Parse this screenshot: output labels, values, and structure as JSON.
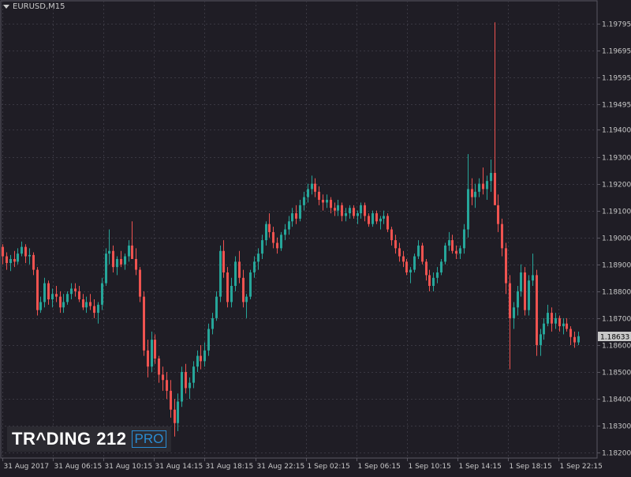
{
  "chart_data": {
    "type": "candlestick",
    "symbol": "EURUSD,M15",
    "current_price": "1.18633",
    "ylim": [
      1.1818,
      1.1988
    ],
    "y_ticks": [
      "1.19795",
      "1.19695",
      "1.19595",
      "1.19495",
      "1.19400",
      "1.19300",
      "1.19200",
      "1.19100",
      "1.19000",
      "1.18900",
      "1.18800",
      "1.18700",
      "1.18600",
      "1.18500",
      "1.18400",
      "1.18300",
      "1.18200"
    ],
    "x_ticks": [
      "31 Aug 2017",
      "31 Aug 06:15",
      "31 Aug 10:15",
      "31 Aug 14:15",
      "31 Aug 18:15",
      "31 Aug 22:15",
      "1 Sep 02:15",
      "1 Sep 06:15",
      "1 Sep 10:15",
      "1 Sep 14:15",
      "1 Sep 18:15",
      "1 Sep 22:15"
    ],
    "grid": true,
    "colors": {
      "up": "#26a69a",
      "down": "#ef5350",
      "grid": "#3a3842",
      "axis": "#5a5862",
      "text": "#c8c8c8",
      "background": "#1f1d25"
    },
    "candles": [
      [
        1.18965,
        1.18975,
        1.189,
        1.1893
      ],
      [
        1.1893,
        1.18945,
        1.1888,
        1.18905
      ],
      [
        1.18905,
        1.18935,
        1.18875,
        1.1892
      ],
      [
        1.1892,
        1.1895,
        1.1889,
        1.1891
      ],
      [
        1.1891,
        1.1896,
        1.189,
        1.1894
      ],
      [
        1.1894,
        1.18985,
        1.1893,
        1.18965
      ],
      [
        1.18965,
        1.18975,
        1.18905,
        1.1893
      ],
      [
        1.1893,
        1.1896,
        1.189,
        1.18935
      ],
      [
        1.18935,
        1.18945,
        1.1886,
        1.1888
      ],
      [
        1.1888,
        1.1889,
        1.1871,
        1.1873
      ],
      [
        1.1873,
        1.1878,
        1.1872,
        1.1876
      ],
      [
        1.1876,
        1.1885,
        1.1874,
        1.1883
      ],
      [
        1.1883,
        1.1884,
        1.1875,
        1.1877
      ],
      [
        1.1877,
        1.1881,
        1.1874,
        1.1879
      ],
      [
        1.1879,
        1.1882,
        1.1876,
        1.1878
      ],
      [
        1.1878,
        1.188,
        1.1872,
        1.1874
      ],
      [
        1.1874,
        1.1879,
        1.1872,
        1.1876
      ],
      [
        1.1876,
        1.188,
        1.1875,
        1.1879
      ],
      [
        1.1879,
        1.1883,
        1.1877,
        1.1881
      ],
      [
        1.1881,
        1.1883,
        1.1878,
        1.188
      ],
      [
        1.188,
        1.1882,
        1.1876,
        1.1877
      ],
      [
        1.1877,
        1.1879,
        1.1873,
        1.1874
      ],
      [
        1.1874,
        1.1878,
        1.1872,
        1.1876
      ],
      [
        1.1876,
        1.1879,
        1.1873,
        1.18745
      ],
      [
        1.18745,
        1.1877,
        1.187,
        1.1872
      ],
      [
        1.1872,
        1.1876,
        1.1868,
        1.1875
      ],
      [
        1.1875,
        1.1885,
        1.1873,
        1.1883
      ],
      [
        1.1883,
        1.1896,
        1.1882,
        1.1894
      ],
      [
        1.1894,
        1.1903,
        1.189,
        1.1895
      ],
      [
        1.1895,
        1.1897,
        1.1887,
        1.1889
      ],
      [
        1.1889,
        1.1893,
        1.1886,
        1.1892
      ],
      [
        1.1892,
        1.1895,
        1.1889,
        1.189
      ],
      [
        1.189,
        1.1894,
        1.1888,
        1.1893
      ],
      [
        1.1893,
        1.1899,
        1.1891,
        1.1897
      ],
      [
        1.1897,
        1.1906,
        1.1894,
        1.1892
      ],
      [
        1.1892,
        1.1896,
        1.1886,
        1.1888
      ],
      [
        1.1888,
        1.1889,
        1.1876,
        1.1878
      ],
      [
        1.1878,
        1.188,
        1.1856,
        1.1858
      ],
      [
        1.1858,
        1.1862,
        1.1848,
        1.1852
      ],
      [
        1.1852,
        1.1865,
        1.185,
        1.1862
      ],
      [
        1.1862,
        1.1864,
        1.1853,
        1.1855
      ],
      [
        1.1855,
        1.1856,
        1.1846,
        1.1849
      ],
      [
        1.1849,
        1.1852,
        1.1843,
        1.1847
      ],
      [
        1.1847,
        1.185,
        1.184,
        1.1843
      ],
      [
        1.1843,
        1.1847,
        1.1833,
        1.1836
      ],
      [
        1.1836,
        1.184,
        1.1826,
        1.1831
      ],
      [
        1.1831,
        1.1842,
        1.1828,
        1.1839
      ],
      [
        1.1839,
        1.1852,
        1.1837,
        1.185
      ],
      [
        1.185,
        1.1853,
        1.1842,
        1.1844
      ],
      [
        1.1844,
        1.1848,
        1.184,
        1.1846
      ],
      [
        1.1846,
        1.1854,
        1.1844,
        1.1852
      ],
      [
        1.1852,
        1.1858,
        1.185,
        1.1856
      ],
      [
        1.1856,
        1.186,
        1.1851,
        1.1854
      ],
      [
        1.1854,
        1.1861,
        1.1852,
        1.1858
      ],
      [
        1.1858,
        1.1868,
        1.1856,
        1.1866
      ],
      [
        1.1866,
        1.1872,
        1.1864,
        1.187
      ],
      [
        1.187,
        1.188,
        1.1869,
        1.1878
      ],
      [
        1.1878,
        1.1897,
        1.1876,
        1.1895
      ],
      [
        1.1895,
        1.1899,
        1.1885,
        1.1887
      ],
      [
        1.1887,
        1.1889,
        1.1874,
        1.1876
      ],
      [
        1.1876,
        1.1885,
        1.1874,
        1.1882
      ],
      [
        1.1882,
        1.1893,
        1.188,
        1.1891
      ],
      [
        1.1891,
        1.1895,
        1.1883,
        1.1885
      ],
      [
        1.1885,
        1.1888,
        1.1874,
        1.1876
      ],
      [
        1.1876,
        1.1879,
        1.187,
        1.1878
      ],
      [
        1.1878,
        1.1888,
        1.1877,
        1.1887
      ],
      [
        1.1887,
        1.1893,
        1.1885,
        1.1891
      ],
      [
        1.1891,
        1.1896,
        1.1888,
        1.1894
      ],
      [
        1.1894,
        1.1901,
        1.1892,
        1.1899
      ],
      [
        1.1899,
        1.1906,
        1.1897,
        1.1905
      ],
      [
        1.1905,
        1.1909,
        1.19,
        1.1902
      ],
      [
        1.1902,
        1.1904,
        1.1896,
        1.1898
      ],
      [
        1.1898,
        1.19,
        1.1894,
        1.1896
      ],
      [
        1.1896,
        1.1902,
        1.1895,
        1.1901
      ],
      [
        1.1901,
        1.1905,
        1.1899,
        1.1903
      ],
      [
        1.1903,
        1.1908,
        1.1901,
        1.1906
      ],
      [
        1.1906,
        1.1911,
        1.1904,
        1.1909
      ],
      [
        1.1909,
        1.1912,
        1.1905,
        1.1907
      ],
      [
        1.1907,
        1.1914,
        1.1906,
        1.1912
      ],
      [
        1.1912,
        1.1917,
        1.191,
        1.1915
      ],
      [
        1.1915,
        1.192,
        1.1913,
        1.1918
      ],
      [
        1.1918,
        1.1923,
        1.1916,
        1.192
      ],
      [
        1.192,
        1.1922,
        1.1915,
        1.1917
      ],
      [
        1.1917,
        1.1919,
        1.1912,
        1.1914
      ],
      [
        1.1914,
        1.1916,
        1.191,
        1.1913
      ],
      [
        1.1913,
        1.1916,
        1.1911,
        1.1914
      ],
      [
        1.1914,
        1.1915,
        1.1909,
        1.1911
      ],
      [
        1.1911,
        1.1913,
        1.1908,
        1.191
      ],
      [
        1.191,
        1.1914,
        1.1908,
        1.1912
      ],
      [
        1.1912,
        1.1913,
        1.1906,
        1.1908
      ],
      [
        1.1908,
        1.1911,
        1.1906,
        1.1909
      ],
      [
        1.1909,
        1.1912,
        1.1907,
        1.1911
      ],
      [
        1.1911,
        1.1912,
        1.1907,
        1.1908
      ],
      [
        1.1908,
        1.191,
        1.1905,
        1.1909
      ],
      [
        1.1909,
        1.1913,
        1.1907,
        1.1912
      ],
      [
        1.1912,
        1.1913,
        1.1906,
        1.1908
      ],
      [
        1.1908,
        1.1909,
        1.1904,
        1.1905
      ],
      [
        1.1905,
        1.191,
        1.1904,
        1.1909
      ],
      [
        1.1909,
        1.191,
        1.1905,
        1.1906
      ],
      [
        1.1906,
        1.1908,
        1.1903,
        1.1907
      ],
      [
        1.1907,
        1.191,
        1.1905,
        1.1908
      ],
      [
        1.1908,
        1.1909,
        1.1902,
        1.1903
      ],
      [
        1.1903,
        1.1904,
        1.1897,
        1.1899
      ],
      [
        1.1899,
        1.1901,
        1.1894,
        1.1896
      ],
      [
        1.1896,
        1.1898,
        1.1891,
        1.1893
      ],
      [
        1.1893,
        1.1895,
        1.1889,
        1.1891
      ],
      [
        1.1891,
        1.1892,
        1.1886,
        1.1887
      ],
      [
        1.1887,
        1.1889,
        1.1883,
        1.1888
      ],
      [
        1.1888,
        1.1894,
        1.1887,
        1.1893
      ],
      [
        1.1893,
        1.1899,
        1.1892,
        1.1897
      ],
      [
        1.1897,
        1.1898,
        1.189,
        1.1891
      ],
      [
        1.1891,
        1.1892,
        1.1884,
        1.1886
      ],
      [
        1.1886,
        1.1888,
        1.188,
        1.1882
      ],
      [
        1.1882,
        1.1887,
        1.188,
        1.1885
      ],
      [
        1.1885,
        1.1889,
        1.1883,
        1.1887
      ],
      [
        1.1887,
        1.1892,
        1.1886,
        1.1891
      ],
      [
        1.1891,
        1.1898,
        1.189,
        1.1897
      ],
      [
        1.1897,
        1.1902,
        1.1895,
        1.1899
      ],
      [
        1.1899,
        1.1901,
        1.1894,
        1.1895
      ],
      [
        1.1895,
        1.1897,
        1.1892,
        1.1894
      ],
      [
        1.1894,
        1.1897,
        1.1892,
        1.1896
      ],
      [
        1.1896,
        1.1905,
        1.1894,
        1.1903
      ],
      [
        1.1903,
        1.1931,
        1.19,
        1.1918
      ],
      [
        1.1918,
        1.1922,
        1.1912,
        1.1915
      ],
      [
        1.1915,
        1.192,
        1.1911,
        1.1917
      ],
      [
        1.1917,
        1.1922,
        1.1915,
        1.192
      ],
      [
        1.192,
        1.1926,
        1.1916,
        1.1918
      ],
      [
        1.1918,
        1.1923,
        1.1914,
        1.1921
      ],
      [
        1.1921,
        1.1929,
        1.1917,
        1.1924
      ],
      [
        1.1924,
        1.198,
        1.1918,
        1.1912
      ],
      [
        1.1912,
        1.1916,
        1.1902,
        1.1905
      ],
      [
        1.1905,
        1.1907,
        1.1893,
        1.1896
      ],
      [
        1.1896,
        1.1898,
        1.1879,
        1.1883
      ],
      [
        1.1883,
        1.1886,
        1.1851,
        1.187
      ],
      [
        1.187,
        1.1876,
        1.1866,
        1.1874
      ],
      [
        1.1874,
        1.1882,
        1.1871,
        1.188
      ],
      [
        1.188,
        1.189,
        1.1878,
        1.1887
      ],
      [
        1.1887,
        1.1889,
        1.1871,
        1.1873
      ],
      [
        1.1873,
        1.1886,
        1.1871,
        1.1884
      ],
      [
        1.1884,
        1.1894,
        1.1882,
        1.1886
      ],
      [
        1.1886,
        1.1888,
        1.1856,
        1.186
      ],
      [
        1.186,
        1.1866,
        1.1856,
        1.1864
      ],
      [
        1.1864,
        1.187,
        1.1862,
        1.1868
      ],
      [
        1.1868,
        1.1875,
        1.1867,
        1.1872
      ],
      [
        1.1872,
        1.1874,
        1.1865,
        1.1868
      ],
      [
        1.1868,
        1.1872,
        1.1866,
        1.187
      ],
      [
        1.187,
        1.1871,
        1.1865,
        1.1867
      ],
      [
        1.1867,
        1.187,
        1.1864,
        1.1868
      ],
      [
        1.1868,
        1.187,
        1.1865,
        1.1866
      ],
      [
        1.1866,
        1.1867,
        1.186,
        1.1863
      ],
      [
        1.1863,
        1.1865,
        1.1859,
        1.1861
      ],
      [
        1.1861,
        1.1865,
        1.186,
        1.18633
      ]
    ]
  },
  "logo": {
    "brand": "TR^DING 212",
    "badge": "PRO"
  }
}
